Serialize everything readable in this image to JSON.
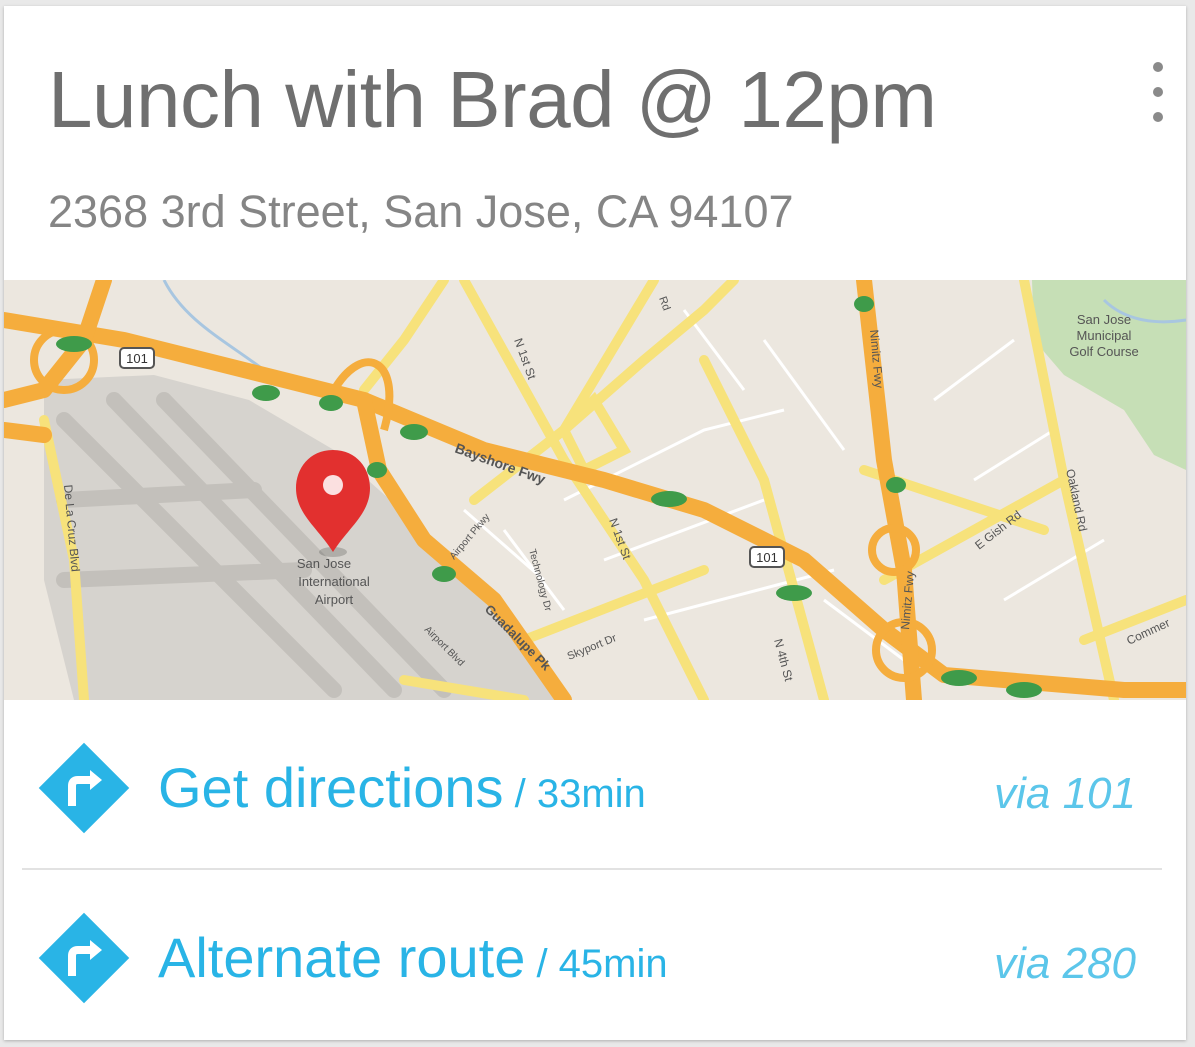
{
  "card": {
    "title": "Lunch with Brad @ 12pm",
    "address": "2368 3rd Street, San Jose, CA 94107",
    "menu_icon": "more-vert-icon"
  },
  "map": {
    "labels": {
      "golf": [
        "San Jose",
        "Municipal",
        "Golf Course"
      ],
      "airport": [
        "San Jose",
        "International",
        "Airport"
      ],
      "bayshore": "Bayshore Fwy",
      "guadalupe": "Guadalupe Pk",
      "n1st_a": "N 1st St",
      "n1st_b": "N 1st St",
      "n4th": "N 4th St",
      "nimitz_a": "Nimitz Fwy",
      "nimitz_b": "Nimitz Fwy",
      "oakland": "Oakland Rd",
      "egish": "E Gish Rd",
      "delacruz": "De La Cruz Blvd",
      "airportpkwy": "Airport Pkwy",
      "technology": "Technology Dr",
      "skyport": "Skyport Dr",
      "airportblvd": "Airport Blvd",
      "commercial": "Commer",
      "shield_101": "101",
      "shield_101b": "101",
      "zanker": "Rd"
    },
    "marker_icon": "map-pin-icon",
    "colors": {
      "freeway": "#f5ad3d",
      "road": "#f7e27b",
      "land": "#ece7df",
      "airport": "#d4d1cc",
      "park": "#c6dfb6",
      "marker": "#e2302f"
    }
  },
  "routes": [
    {
      "label": "Get directions",
      "duration": " / 33min",
      "via": "via 101",
      "icon": "directions-turn-right-icon"
    },
    {
      "label": "Alternate route",
      "duration": " / 45min",
      "via": "via 280",
      "icon": "directions-turn-right-icon"
    }
  ],
  "colors": {
    "accent": "#29b4e6",
    "title": "#6f6f6f",
    "subtitle": "#858585"
  }
}
